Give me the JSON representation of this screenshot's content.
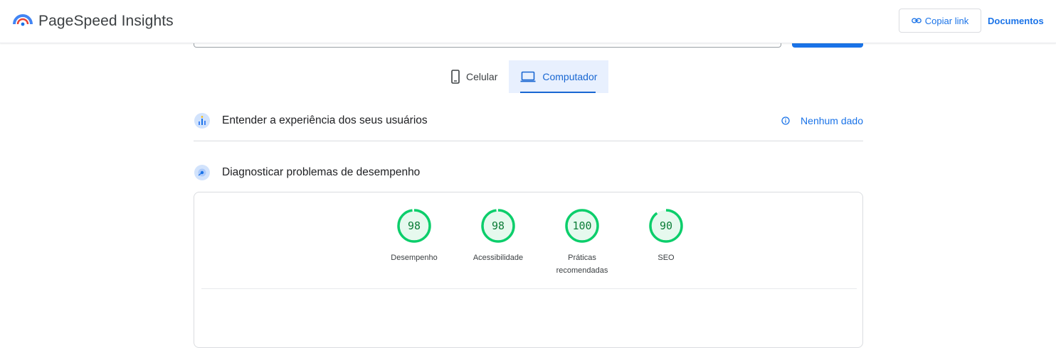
{
  "header": {
    "brand_name": "PageSpeed Insights",
    "copy_link_label": "Copiar link",
    "docs_label": "Documentos",
    "logo_icon": "pagespeed-logo-icon",
    "link_icon": "link-icon"
  },
  "device_tabs": [
    {
      "label": "Celular",
      "icon": "phone-icon",
      "active": false
    },
    {
      "label": "Computador",
      "icon": "laptop-icon",
      "active": true
    }
  ],
  "field_data": {
    "title": "Entender a experiência dos seus usuários",
    "status": "Nenhum dado",
    "status_icon": "info-icon"
  },
  "lab_data": {
    "title": "Diagnosticar problemas de desempenho"
  },
  "scores": [
    {
      "value": "98",
      "score": 98,
      "label": "Desempenho"
    },
    {
      "value": "98",
      "score": 98,
      "label": "Acessibilidade"
    },
    {
      "value": "100",
      "score": 100,
      "label": "Práticas recomendadas"
    },
    {
      "value": "90",
      "score": 90,
      "label": "SEO"
    }
  ],
  "colors": {
    "accent": "#1a73e8",
    "pass": "#0cce6b",
    "pass_text": "#0c7d37",
    "tab_active_bg": "#e8f0fe"
  }
}
